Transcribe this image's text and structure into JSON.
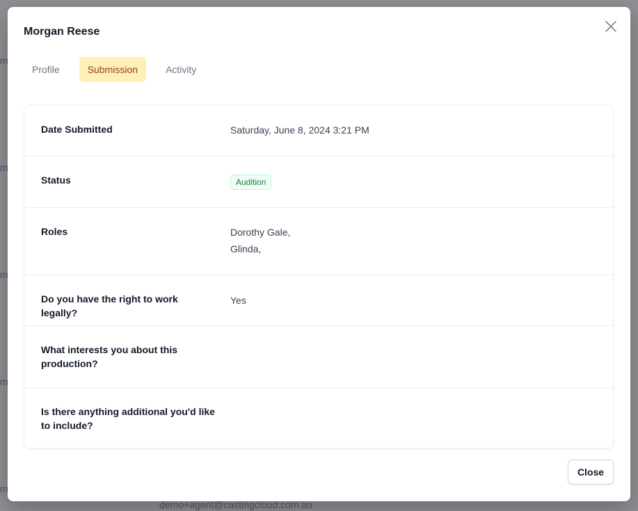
{
  "backdrop": {
    "row_initials": [
      "m",
      "m",
      "m",
      "m",
      "m"
    ],
    "email_text": "demo+agent@castingcloud.com.au"
  },
  "modal": {
    "title": "Morgan Reese",
    "close_icon": "close-icon",
    "tabs": [
      {
        "label": "Profile",
        "active": false
      },
      {
        "label": "Submission",
        "active": true
      },
      {
        "label": "Activity",
        "active": false
      }
    ],
    "accent_color": "#fdf1b9",
    "details": {
      "date_submitted": {
        "label": "Date Submitted",
        "value": "Saturday, June 8, 2024 3:21 PM"
      },
      "status": {
        "label": "Status",
        "value": "Audition",
        "color": "#15803d"
      },
      "roles": {
        "label": "Roles",
        "values": [
          "Dorothy Gale,",
          "Glinda,"
        ]
      },
      "right_to_work": {
        "label": "Do you have the right to work legally?",
        "value": "Yes"
      },
      "interests": {
        "label": "What interests you about this production?",
        "value": ""
      },
      "additional": {
        "label": "Is there anything additional you'd like to include?",
        "value": ""
      }
    },
    "close_button_label": "Close"
  }
}
